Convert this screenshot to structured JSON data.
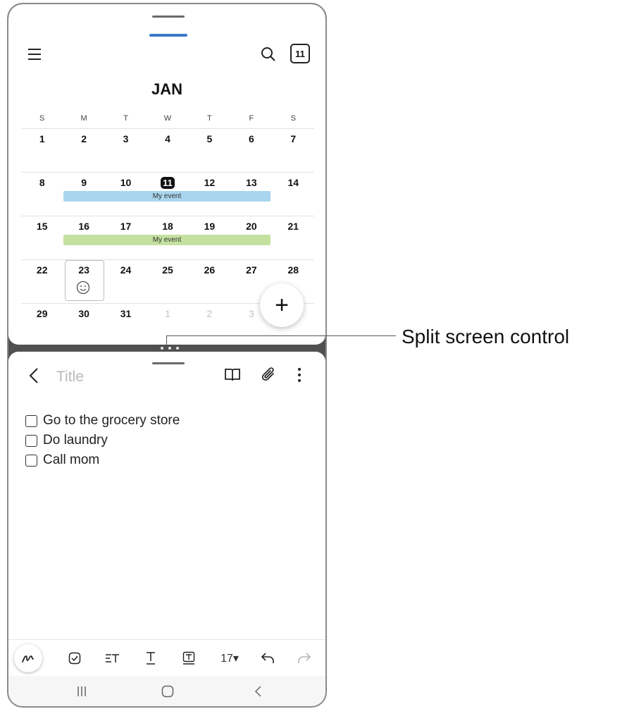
{
  "calendar": {
    "month": "JAN",
    "today_badge": "11",
    "day_headers": [
      "S",
      "M",
      "T",
      "W",
      "T",
      "F",
      "S"
    ],
    "weeks": [
      [
        "1",
        "2",
        "3",
        "4",
        "5",
        "6",
        "7"
      ],
      [
        "8",
        "9",
        "10",
        "11",
        "12",
        "13",
        "14"
      ],
      [
        "15",
        "16",
        "17",
        "18",
        "19",
        "20",
        "21"
      ],
      [
        "22",
        "23",
        "24",
        "25",
        "26",
        "27",
        "28"
      ],
      [
        "29",
        "30",
        "31",
        "1",
        "2",
        "3",
        ""
      ]
    ],
    "events": [
      {
        "label": "My event",
        "color": "#a9d6ee"
      },
      {
        "label": "My event",
        "color": "#c5e1a0"
      }
    ],
    "add_button": "+"
  },
  "note": {
    "title_placeholder": "Title",
    "items": [
      "Go to the grocery store",
      "Do laundry",
      "Call mom"
    ],
    "font_size": "17▾"
  },
  "callout": {
    "label": "Split screen control"
  },
  "colors": {
    "accent_blue": "#3b78c9",
    "divider": "#505050"
  }
}
